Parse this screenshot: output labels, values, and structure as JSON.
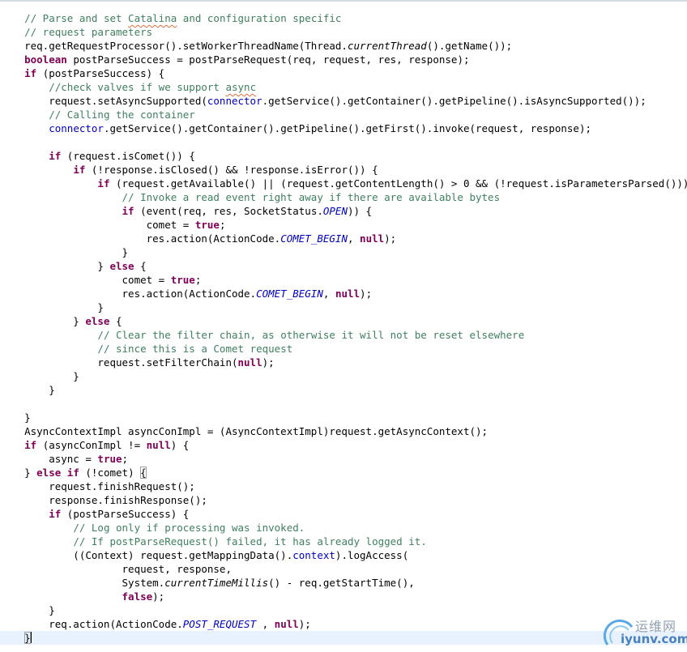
{
  "editor": {
    "lines": [
      [
        [
          "    ",
          ""
        ],
        [
          "// Parse and set ",
          "cm"
        ],
        [
          "Catalina",
          "cm squig"
        ],
        [
          " and configuration specific",
          "cm"
        ]
      ],
      [
        [
          "    ",
          ""
        ],
        [
          "// request parameters",
          "cm"
        ]
      ],
      [
        [
          "    req.getRequestProcessor().setWorkerThreadName(Thread.",
          ""
        ],
        [
          "currentThread",
          "st"
        ],
        [
          "().getName());",
          ""
        ]
      ],
      [
        [
          "    ",
          ""
        ],
        [
          "boolean",
          "kw"
        ],
        [
          " postParseSuccess = postParseRequest(req, request, res, response);",
          ""
        ]
      ],
      [
        [
          "    ",
          ""
        ],
        [
          "if",
          "kw"
        ],
        [
          " (postParseSuccess) {",
          ""
        ]
      ],
      [
        [
          "        ",
          ""
        ],
        [
          "//check valves if we support ",
          "cm"
        ],
        [
          "async",
          "cm squig"
        ]
      ],
      [
        [
          "        request.setAsyncSupported(",
          ""
        ],
        [
          "connector",
          "fld"
        ],
        [
          ".getService().getContainer().getPipeline().isAsyncSupported());",
          ""
        ]
      ],
      [
        [
          "        ",
          ""
        ],
        [
          "// Calling the container",
          "cm"
        ]
      ],
      [
        [
          "        ",
          ""
        ],
        [
          "connector",
          "fld"
        ],
        [
          ".getService().getContainer().getPipeline().getFirst().invoke(request, response);",
          ""
        ]
      ],
      [],
      [
        [
          "        ",
          ""
        ],
        [
          "if",
          "kw"
        ],
        [
          " (request.isComet()) {",
          ""
        ]
      ],
      [
        [
          "            ",
          ""
        ],
        [
          "if",
          "kw"
        ],
        [
          " (!response.isClosed() && !response.isError()) {",
          ""
        ]
      ],
      [
        [
          "                ",
          ""
        ],
        [
          "if",
          "kw"
        ],
        [
          " (request.getAvailable() || (request.getContentLength() > 0 && (!request.isParametersParsed()))) {",
          ""
        ]
      ],
      [
        [
          "                    ",
          ""
        ],
        [
          "// Invoke a read event right away if there are available bytes",
          "cm"
        ]
      ],
      [
        [
          "                    ",
          ""
        ],
        [
          "if",
          "kw"
        ],
        [
          " (event(req, res, SocketStatus.",
          ""
        ],
        [
          "OPEN",
          "stc"
        ],
        [
          ")) {",
          ""
        ]
      ],
      [
        [
          "                        comet = ",
          ""
        ],
        [
          "true",
          "kw"
        ],
        [
          ";",
          ""
        ]
      ],
      [
        [
          "                        res.action(ActionCode.",
          ""
        ],
        [
          "COMET_BEGIN",
          "stc"
        ],
        [
          ", ",
          ""
        ],
        [
          "null",
          "kw"
        ],
        [
          ");",
          ""
        ]
      ],
      [
        [
          "                    }",
          ""
        ]
      ],
      [
        [
          "                } ",
          ""
        ],
        [
          "else",
          "kw"
        ],
        [
          " {",
          ""
        ]
      ],
      [
        [
          "                    comet = ",
          ""
        ],
        [
          "true",
          "kw"
        ],
        [
          ";",
          ""
        ]
      ],
      [
        [
          "                    res.action(ActionCode.",
          ""
        ],
        [
          "COMET_BEGIN",
          "stc"
        ],
        [
          ", ",
          ""
        ],
        [
          "null",
          "kw"
        ],
        [
          ");",
          ""
        ]
      ],
      [
        [
          "                }",
          ""
        ]
      ],
      [
        [
          "            } ",
          ""
        ],
        [
          "else",
          "kw"
        ],
        [
          " {",
          ""
        ]
      ],
      [
        [
          "                ",
          ""
        ],
        [
          "// Clear the filter chain, as otherwise it will not be reset elsewhere",
          "cm"
        ]
      ],
      [
        [
          "                ",
          ""
        ],
        [
          "// since this is a Comet request",
          "cm"
        ]
      ],
      [
        [
          "                request.setFilterChain(",
          ""
        ],
        [
          "null",
          "kw"
        ],
        [
          ");",
          ""
        ]
      ],
      [
        [
          "            }",
          ""
        ]
      ],
      [
        [
          "        }",
          ""
        ]
      ],
      [],
      [
        [
          "    }",
          ""
        ]
      ],
      [
        [
          "    AsyncContextImpl asyncConImpl = (AsyncContextImpl)request.getAsyncContext();",
          ""
        ]
      ],
      [
        [
          "    ",
          ""
        ],
        [
          "if",
          "kw"
        ],
        [
          " (asyncConImpl != ",
          ""
        ],
        [
          "null",
          "kw"
        ],
        [
          ") {",
          ""
        ]
      ],
      [
        [
          "        async = ",
          ""
        ],
        [
          "true",
          "kw"
        ],
        [
          ";",
          ""
        ]
      ],
      [
        [
          "    } ",
          ""
        ],
        [
          "else",
          "kw"
        ],
        [
          " ",
          ""
        ],
        [
          "if",
          "kw"
        ],
        [
          " (!comet) ",
          ""
        ],
        [
          "{",
          "boxed"
        ]
      ],
      [
        [
          "        request.finishRequest();",
          ""
        ]
      ],
      [
        [
          "        response.finishResponse();",
          ""
        ]
      ],
      [
        [
          "        ",
          ""
        ],
        [
          "if",
          "kw"
        ],
        [
          " (postParseSuccess) {",
          ""
        ]
      ],
      [
        [
          "            ",
          ""
        ],
        [
          "// Log only if processing was invoked.",
          "cm"
        ]
      ],
      [
        [
          "            ",
          ""
        ],
        [
          "// If postParseRequest() failed, it has already logged it.",
          "cm"
        ]
      ],
      [
        [
          "            ((Context) request.getMappingData().",
          ""
        ],
        [
          "context",
          "fld"
        ],
        [
          ").logAccess(",
          ""
        ]
      ],
      [
        [
          "                    request, response,",
          ""
        ]
      ],
      [
        [
          "                    System.",
          ""
        ],
        [
          "currentTimeMillis",
          "st"
        ],
        [
          "() - req.getStartTime(),",
          ""
        ]
      ],
      [
        [
          "                    ",
          ""
        ],
        [
          "false",
          "kw"
        ],
        [
          ");",
          ""
        ]
      ],
      [
        [
          "        }",
          ""
        ]
      ],
      [
        [
          "        req.action(ActionCode.",
          ""
        ],
        [
          "POST_REQUEST",
          "stc"
        ],
        [
          " , ",
          ""
        ],
        [
          "null",
          "kw"
        ],
        [
          ");",
          ""
        ]
      ],
      [
        [
          "    ",
          ""
        ],
        [
          "}",
          "boxed"
        ]
      ]
    ],
    "current_line": 45
  },
  "watermark": {
    "cn": "运维网",
    "en": "iyunv.com"
  }
}
